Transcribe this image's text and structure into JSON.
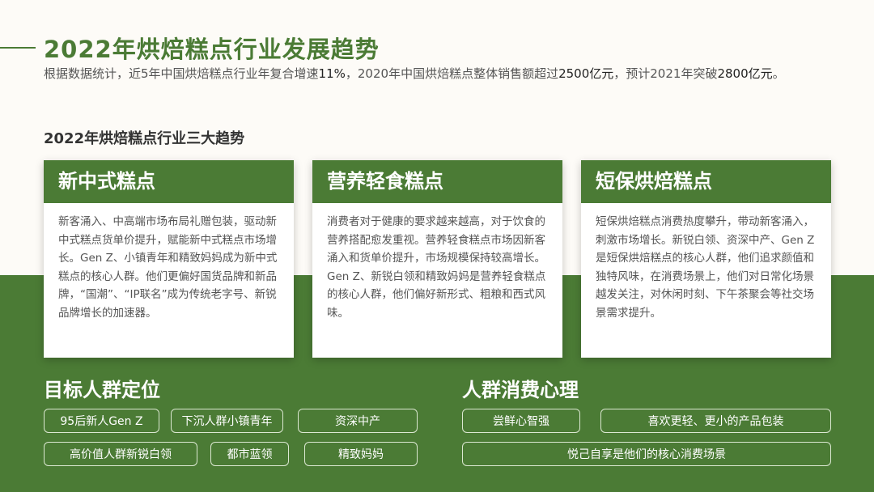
{
  "title": "2022年烘焙糕点行业发展趋势",
  "subtitle": {
    "p1": "根据数据统计，近5年中国烘焙糕点行业年复合增速",
    "v1": "11%",
    "p2": "，2020年中国烘焙糕点整体销售额超过",
    "v2": "2500亿元",
    "p3": "，预计2021年突破",
    "v3": "2800亿元",
    "p4": "。"
  },
  "section_title": "2022年烘焙糕点行业三大趋势",
  "cards": [
    {
      "title": "新中式糕点",
      "body": "新客涌入、中高端市场布局礼赠包装，驱动新中式糕点货单价提升，赋能新中式糕点市场增长。Gen Z、小镇青年和精致妈妈成为新中式糕点的核心人群。他们更偏好国货品牌和新品牌，“国潮”、“IP联名”成为传统老字号、新锐品牌增长的加速器。"
    },
    {
      "title": "营养轻食糕点",
      "body": "消费者对于健康的要求越来越高，对于饮食的营养搭配愈发重视。营养轻食糕点市场因新客涌入和货单价提升，市场规模保持较高增长。Gen Z、新锐白领和精致妈妈是营养轻食糕点的核心人群，他们偏好新形式、粗粮和西式风味。"
    },
    {
      "title": "短保烘焙糕点",
      "body": "短保烘焙糕点消费热度攀升，带动新客涌入，刺激市场增长。新锐白领、资深中产、Gen Z是短保烘焙糕点的核心人群，他们追求颜值和独特风味，在消费场景上，他们对日常化场景越发关注，对休闲时刻、下午茶聚会等社交场景需求提升。"
    }
  ],
  "target_group": {
    "title": "目标人群定位",
    "tags": [
      "95后新人Gen Z",
      "下沉人群小镇青年",
      "资深中产",
      "高价值人群新锐白领",
      "都市蓝领",
      "精致妈妈"
    ]
  },
  "psychology": {
    "title": "人群消费心理",
    "tags": [
      "尝鲜心智强",
      "喜欢更轻、更小的产品包装",
      "悦己自享是他们的核心消费场景"
    ]
  },
  "colors": {
    "brand_green": "#4b7b35",
    "background": "#fdfbf7",
    "card": "#ffffff"
  }
}
